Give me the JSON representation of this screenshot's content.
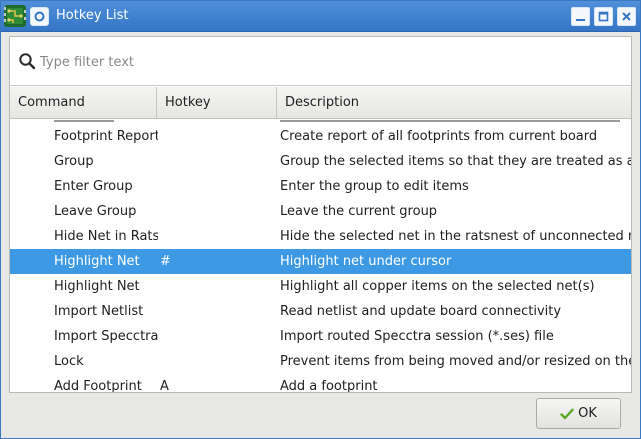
{
  "window": {
    "title": "Hotkey List",
    "accent": "#3475c6"
  },
  "search": {
    "placeholder": "Type filter text",
    "value": ""
  },
  "columns": [
    "Command",
    "Hotkey",
    "Description"
  ],
  "rows": [
    {
      "command": "Footprint Report",
      "hotkey": "",
      "description": "Create report of all footprints from current board"
    },
    {
      "command": "Group",
      "hotkey": "",
      "description": "Group the selected items so that they are treated as a sing"
    },
    {
      "command": "Enter Group",
      "hotkey": "",
      "description": "Enter the group to edit items"
    },
    {
      "command": "Leave Group",
      "hotkey": "",
      "description": "Leave the current group"
    },
    {
      "command": "Hide Net in Ratsn",
      "hotkey": "",
      "description": "Hide the selected net in the ratsnest of unconnected net l"
    },
    {
      "command": "Highlight Net",
      "hotkey": "#",
      "description": "Highlight net under cursor",
      "selected": true
    },
    {
      "command": "Highlight Net",
      "hotkey": "",
      "description": "Highlight all copper items on the selected net(s)"
    },
    {
      "command": "Import Netlist",
      "hotkey": "",
      "description": "Read netlist and update board connectivity"
    },
    {
      "command": "Import Specctra",
      "hotkey": "",
      "description": "Import routed Specctra session (*.ses) file"
    },
    {
      "command": "Lock",
      "hotkey": "",
      "description": "Prevent items from being moved and/or resized on the ca"
    },
    {
      "command": "Add Footprint",
      "hotkey": "A",
      "description": "Add a footprint"
    }
  ],
  "footer": {
    "ok_label": "OK",
    "ok_icon": "check-icon"
  },
  "colors": {
    "selection": "#3d99e4",
    "check": "#5aa826"
  }
}
